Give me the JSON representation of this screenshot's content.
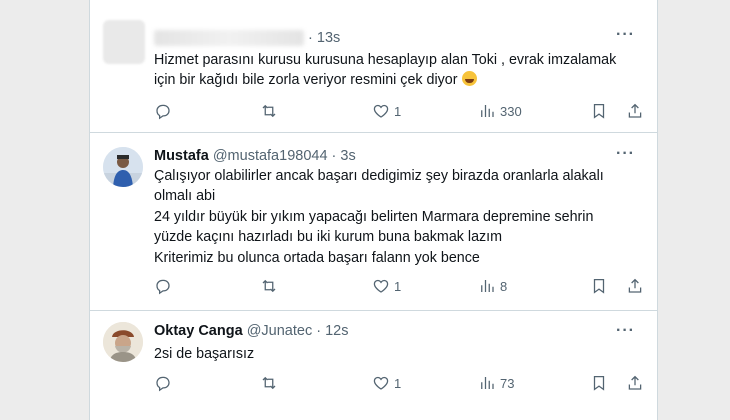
{
  "tweets": [
    {
      "name": "",
      "handle": "",
      "time": "13s",
      "lines": [
        "Hizmet parasını kurusu kurusuna hesaplayıp alan Toki , evrak imzalamak",
        "için bir kağıdı bile zorla veriyor resmini çek diyor"
      ],
      "emoji": "grinning-face-emoji",
      "likes": "1",
      "views": "330",
      "retweets": "",
      "replies": ""
    },
    {
      "name": "Mustafa",
      "handle": "@mustafa198044",
      "time": "3s",
      "lines": [
        "Çalışıyor olabilirler ancak başarı dedigimiz şey birazda oranlarla alakalı",
        "olmalı abi",
        "24 yıldır büyük bir yıkım yapacağı belirten Marmara depremine sehrin",
        "yüzde kaçını hazırladı bu iki kurum buna bakmak lazım",
        "Kriterimiz bu olunca ortada başarı falann yok bence"
      ],
      "likes": "1",
      "views": "8"
    },
    {
      "name": "Oktay Canga",
      "handle": "@Junatec",
      "time": "12s",
      "lines": [
        "2si de başarısız"
      ],
      "likes": "1",
      "views": "73"
    }
  ],
  "separator": "·",
  "more_glyph": "···",
  "icons": {
    "reply": "reply-icon",
    "retweet": "retweet-icon",
    "like": "heart-icon",
    "views": "views-icon",
    "bookmark": "bookmark-icon",
    "share": "share-icon"
  },
  "colors": {
    "text": "#0f1419",
    "muted": "#536471",
    "border": "#cfd9de"
  }
}
